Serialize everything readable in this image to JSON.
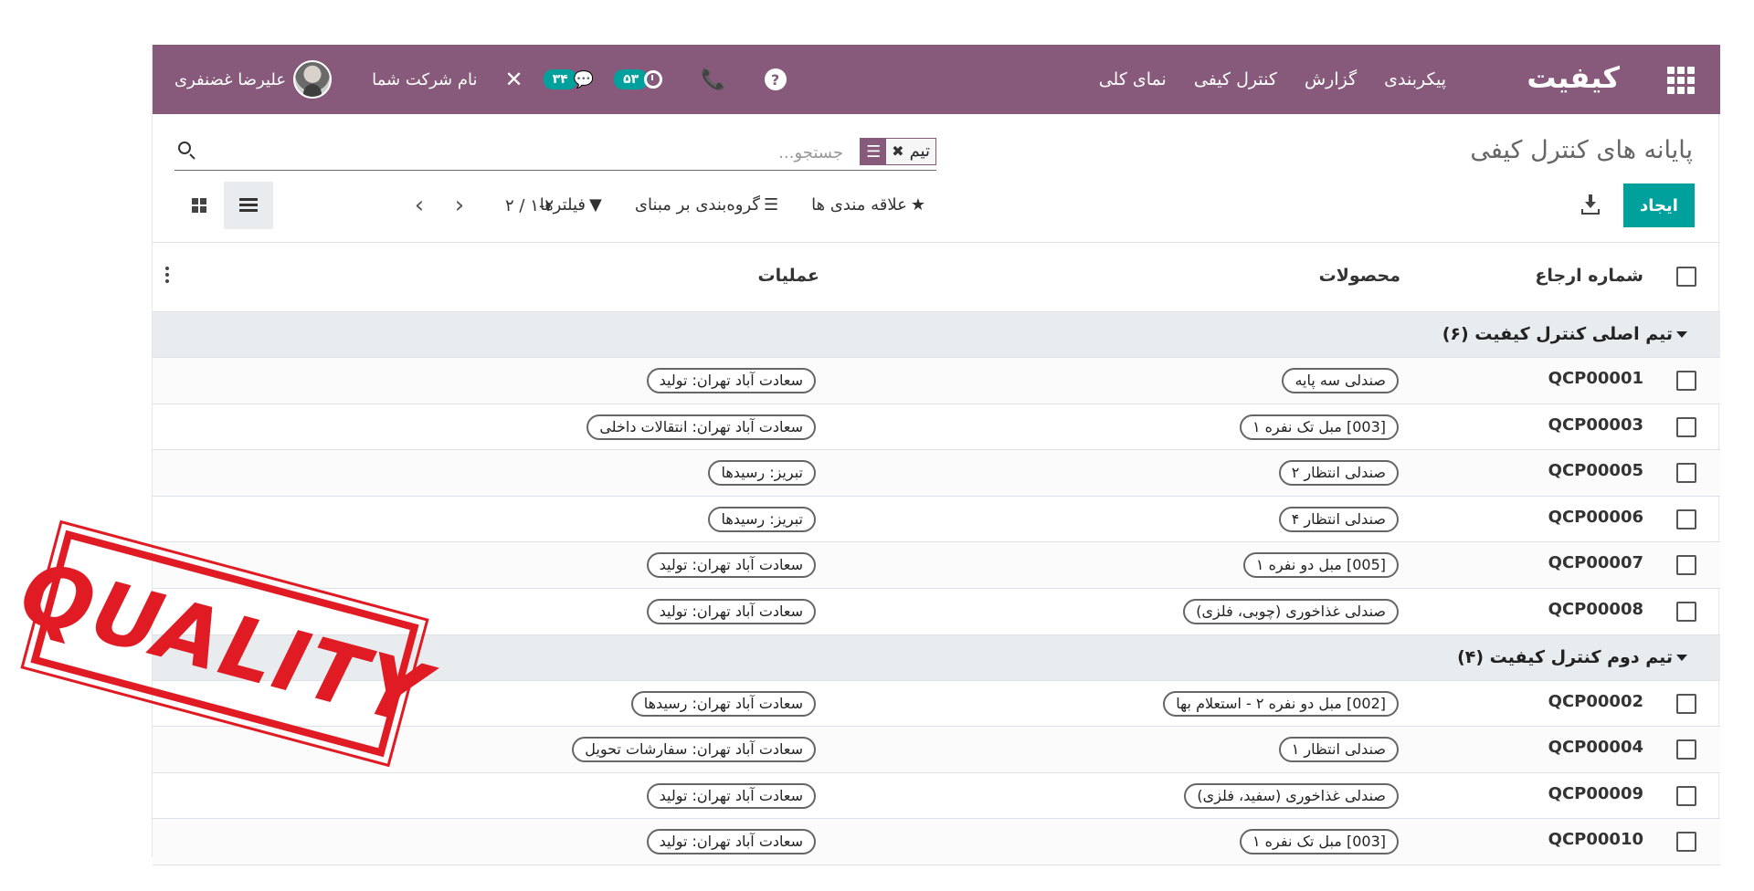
{
  "navbar": {
    "brand": "کیفیت",
    "menu": [
      "نمای کلی",
      "کنترل کیفی",
      "گزارش",
      "پیکربندی"
    ],
    "help_glyph": "?",
    "phone_glyph": "📞",
    "activity_count": "۵۳",
    "messages_count": "۳۴",
    "tool_glyph": "✕",
    "company_name": "نام شرکت شما",
    "user_name": "علیرضا غضنفری",
    "background_color": "#875a7b"
  },
  "control_panel": {
    "title": "پایانه های کنترل کیفی",
    "create_label": "ایجاد",
    "search": {
      "facet_value": "تیم",
      "facet_remove_glyph": "✖",
      "placeholder": "جستجو..."
    },
    "filters_label": "فیلترها",
    "group_by_label": "گروه‌بندی بر مبنای",
    "favorites_label": "علاقه مندی ها",
    "pager_value": "۱-۲ / ۲",
    "pager_prev_glyph": "‹",
    "pager_next_glyph": "›",
    "filter_glyph": "▼",
    "group_glyph": "☰",
    "favorite_glyph": "★",
    "accent_color": "#00a09d"
  },
  "table": {
    "headers": {
      "reference": "شماره ارجاع",
      "products": "محصولات",
      "operations": "عملیات"
    },
    "groups": [
      {
        "label": "تیم اصلی کنترل کیفیت (۶)",
        "rows": [
          {
            "ref": "QCP00001",
            "product": "صندلی سه پایه",
            "operation": "سعادت آباد تهران: تولید"
          },
          {
            "ref": "QCP00003",
            "product": "[003] مبل تک نفره ۱",
            "operation": "سعادت آباد تهران: انتقالات داخلی"
          },
          {
            "ref": "QCP00005",
            "product": "صندلی انتظار ۲",
            "operation": "تبریز: رسیدها"
          },
          {
            "ref": "QCP00006",
            "product": "صندلی انتظار ۴",
            "operation": "تبریز: رسیدها"
          },
          {
            "ref": "QCP00007",
            "product": "[005] مبل دو نفره ۱",
            "operation": "سعادت آباد تهران: تولید"
          },
          {
            "ref": "QCP00008",
            "product": "صندلی غذاخوری (چوبی، فلزی)",
            "operation": "سعادت آباد تهران: تولید"
          }
        ]
      },
      {
        "label": "تیم دوم کنترل کیفیت (۴)",
        "rows": [
          {
            "ref": "QCP00002",
            "product": "[002] مبل دو نفره ۲ - استعلام بها",
            "operation": "سعادت آباد تهران: رسیدها"
          },
          {
            "ref": "QCP00004",
            "product": "صندلی انتظار ۱",
            "operation": "سعادت آباد تهران: سفارشات تحویل"
          },
          {
            "ref": "QCP00009",
            "product": "صندلی غذاخوری (سفید، فلزی)",
            "operation": "سعادت آباد تهران: تولید"
          },
          {
            "ref": "QCP00010",
            "product": "[003] مبل تک نفره ۱",
            "operation": "سعادت آباد تهران: تولید"
          }
        ]
      }
    ]
  },
  "stamp": {
    "text": "QUALITY",
    "color": "#e01b24"
  }
}
